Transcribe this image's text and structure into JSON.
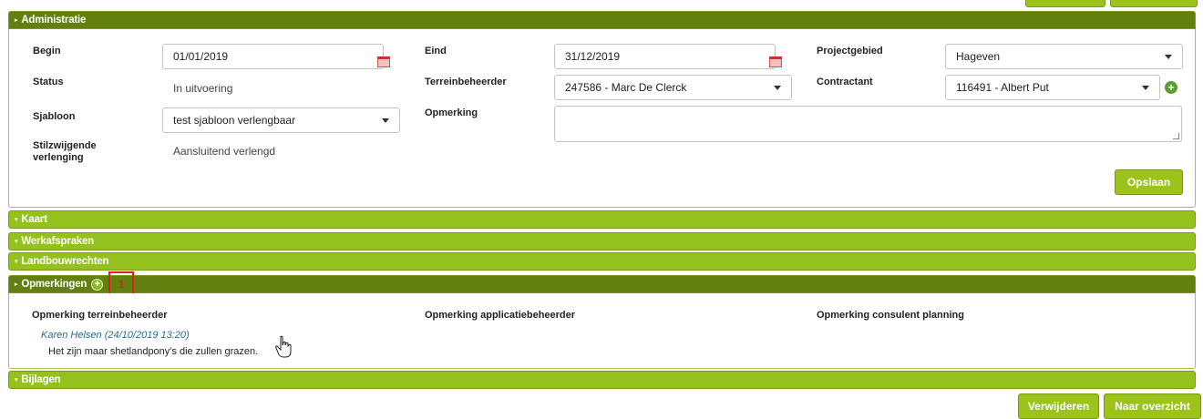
{
  "sections": {
    "administratie": "Administratie",
    "kaart": "Kaart",
    "werkafspraken": "Werkafspraken",
    "landbouwrechten": "Landbouwrechten",
    "opmerkingen": "Opmerkingen",
    "bijlagen": "Bijlagen"
  },
  "admin": {
    "begin_label": "Begin",
    "begin_value": "01/01/2019",
    "eind_label": "Eind",
    "eind_value": "31/12/2019",
    "projectgebied_label": "Projectgebied",
    "projectgebied_value": "Hageven",
    "status_label": "Status",
    "status_value": "In uitvoering",
    "terreinbeheerder_label": "Terreinbeheerder",
    "terreinbeheerder_value": "247586 - Marc De Clerck",
    "contractant_label": "Contractant",
    "contractant_value": "116491 - Albert Put",
    "sjabloon_label": "Sjabloon",
    "sjabloon_value": "test sjabloon verlengbaar",
    "opmerking_label": "Opmerking",
    "opmerking_value": "",
    "stilzwijgende_label_1": "Stilzwijgende",
    "stilzwijgende_label_2": "verlenging",
    "stilzwijgende_value": "Aansluitend verlengd",
    "save_label": "Opslaan"
  },
  "opmerkingen": {
    "count": "1",
    "col_terreinbeheerder": "Opmerking terreinbeheerder",
    "col_applicatiebeheerder": "Opmerking applicatiebeheerder",
    "col_consulent": "Opmerking consulent planning",
    "comment_author": "Karen Helsen (24/10/2019 13:20)",
    "comment_text": "Het zijn maar shetlandpony's die zullen grazen."
  },
  "footer": {
    "delete_label": "Verwijderen",
    "overview_label": "Naar overzicht"
  },
  "colors": {
    "header_dark": "#637f10",
    "header_light": "#95c11f",
    "button_green": "#9cc31a",
    "highlight_red": "#e02020"
  }
}
